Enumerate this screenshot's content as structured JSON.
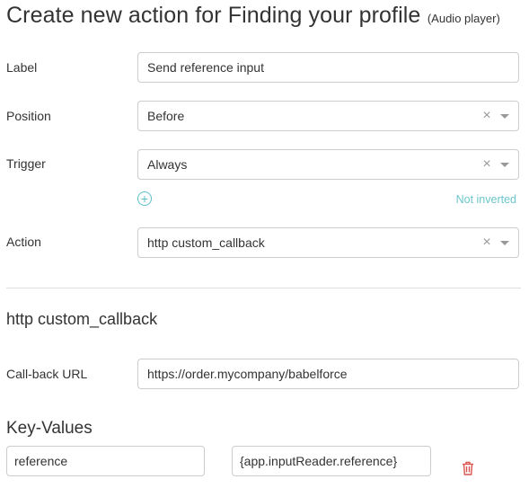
{
  "header": {
    "title": "Create new action for Finding your profile",
    "subtitle": "(Audio player)"
  },
  "form": {
    "label": {
      "label": "Label",
      "value": "Send reference input"
    },
    "position": {
      "label": "Position",
      "value": "Before",
      "clear_glyph": "×"
    },
    "trigger": {
      "label": "Trigger",
      "value": "Always",
      "clear_glyph": "×",
      "add_glyph": "+",
      "inverted_status": "Not inverted"
    },
    "action": {
      "label": "Action",
      "value": "http custom_callback",
      "clear_glyph": "×"
    }
  },
  "callback_section": {
    "title": "http custom_callback",
    "url_label": "Call-back URL",
    "url_value": "https://order.mycompany/babelforce"
  },
  "key_values": {
    "title": "Key-Values",
    "rows": [
      {
        "key": "reference",
        "value": "{app.inputReader.reference}"
      }
    ]
  },
  "colors": {
    "accent": "#5bc0c7",
    "delete": "#d9534f",
    "border": "#cccccc",
    "text": "#333333"
  },
  "icons": {
    "clear": "clear-icon",
    "dropdown": "chevron-down-icon",
    "add": "add-circle-icon",
    "delete": "trash-icon"
  }
}
